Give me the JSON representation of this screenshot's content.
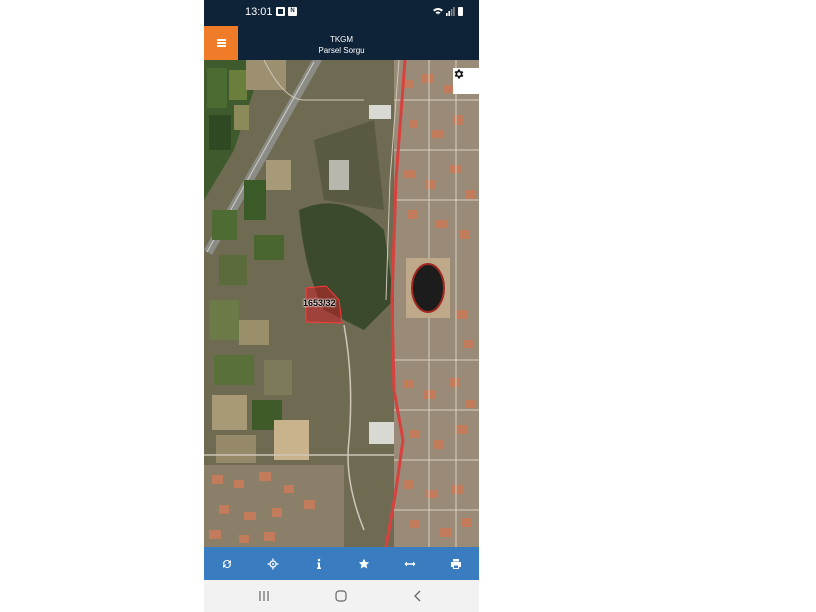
{
  "status_bar": {
    "time": "13:01",
    "icons": [
      "gallery-icon",
      "nd-icon",
      "wifi-icon",
      "signal-icon",
      "battery-icon"
    ]
  },
  "header": {
    "title": "TKGM",
    "subtitle": "Parsel Sorgu",
    "menu_icon": "hamburger-icon",
    "menu_color": "#f07c2a",
    "background": "#0e2337"
  },
  "map": {
    "parcel_label": "1653/32",
    "settings_icon": "gear-icon",
    "parcel_color": "#c8202a"
  },
  "toolbar": {
    "background": "#3a7cc0",
    "buttons": [
      {
        "icon": "refresh-icon"
      },
      {
        "icon": "locate-icon"
      },
      {
        "icon": "info-icon"
      },
      {
        "icon": "star-icon"
      },
      {
        "icon": "measure-icon"
      },
      {
        "icon": "print-icon"
      }
    ]
  },
  "nav_bar": {
    "buttons": [
      "recent-apps-icon",
      "home-icon",
      "back-icon"
    ]
  }
}
